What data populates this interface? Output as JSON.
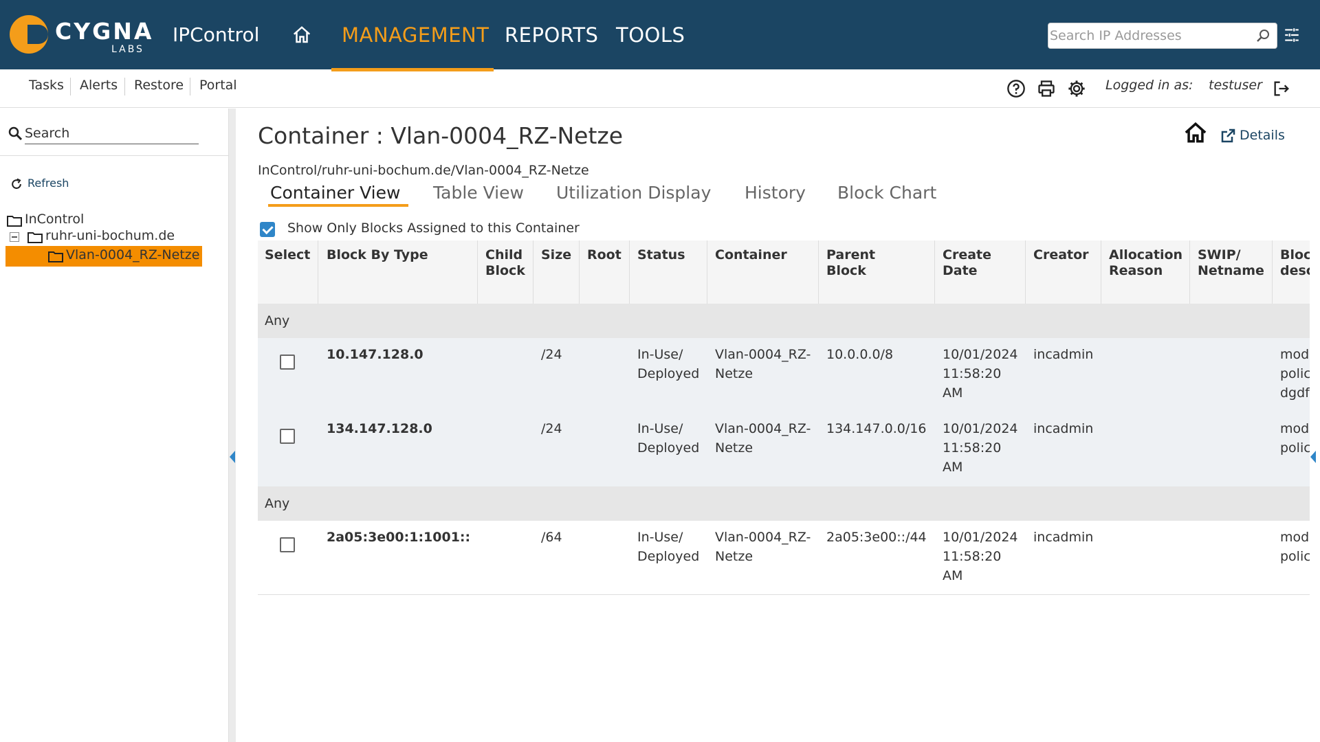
{
  "brand": {
    "logo_word": "CYGNA",
    "logo_sub": "LABS",
    "app_name": "IPControl"
  },
  "nav": {
    "items": [
      {
        "label": "MANAGEMENT",
        "active": true
      },
      {
        "label": "REPORTS",
        "active": false
      },
      {
        "label": "TOOLS",
        "active": false
      }
    ]
  },
  "search": {
    "placeholder": "Search IP Addresses",
    "value": ""
  },
  "subnav": {
    "links": [
      "Tasks",
      "Alerts",
      "Restore",
      "Portal"
    ],
    "logged_in_label": "Logged in as:",
    "username": "testuser"
  },
  "sidebar": {
    "search_placeholder": "Search",
    "refresh_label": "Refresh",
    "tree": [
      {
        "label": "InControl",
        "level": 0
      },
      {
        "label": "ruhr-uni-bochum.de",
        "level": 1
      },
      {
        "label": "Vlan-0004_RZ-Netze",
        "level": 2,
        "selected": true
      }
    ]
  },
  "page": {
    "title": "Container : Vlan-0004_RZ-Netze",
    "breadcrumb": "InControl/ruhr-uni-bochum.de/Vlan-0004_RZ-Netze",
    "details_label": "Details",
    "tabs": [
      {
        "label": "Container View",
        "active": true
      },
      {
        "label": "Table View",
        "active": false
      },
      {
        "label": "Utilization Display",
        "active": false
      },
      {
        "label": "History",
        "active": false
      },
      {
        "label": "Block Chart",
        "active": false
      }
    ],
    "show_only_label": "Show Only Blocks Assigned to this Container",
    "show_only_checked": true
  },
  "table": {
    "headers": {
      "select": "Select",
      "block_by_type": "Block By Type",
      "child_block_1": "Child",
      "child_block_2": "Block",
      "size": "Size",
      "root": "Root",
      "status": "Status",
      "container": "Container",
      "parent_block_1": "Parent",
      "parent_block_2": "Block",
      "create_date_1": "Create",
      "create_date_2": "Date",
      "creator": "Creator",
      "allocation_reason_1": "Allocation",
      "allocation_reason_2": "Reason",
      "swip_1": "SWIP/",
      "swip_2": "Netname",
      "block_desc_1": "Bloc",
      "block_desc_2": "desc"
    },
    "groups": [
      {
        "label": "Any",
        "rows": [
          {
            "block": "10.147.128.0",
            "size": "/24",
            "status_1": "In-Use/",
            "status_2": "Deployed",
            "container_1": "Vlan-0004_RZ-",
            "container_2": "Netze",
            "parent": "10.0.0.0/8",
            "date_1": "10/01/2024",
            "date_2": "11:58:20",
            "date_3": "AM",
            "creator": "incadmin",
            "desc_1": "modi",
            "desc_2": "polic",
            "desc_3": "dgdf"
          },
          {
            "block": "134.147.128.0",
            "size": "/24",
            "status_1": "In-Use/",
            "status_2": "Deployed",
            "container_1": "Vlan-0004_RZ-",
            "container_2": "Netze",
            "parent": "134.147.0.0/16",
            "date_1": "10/01/2024",
            "date_2": "11:58:20",
            "date_3": "AM",
            "creator": "incadmin",
            "desc_1": "modi",
            "desc_2": "polic"
          }
        ]
      },
      {
        "label": "Any",
        "rows": [
          {
            "block": "2a05:3e00:1:1001::",
            "size": "/64",
            "status_1": "In-Use/",
            "status_2": "Deployed",
            "container_1": "Vlan-0004_RZ-",
            "container_2": "Netze",
            "parent": "2a05:3e00::/44",
            "date_1": "10/01/2024",
            "date_2": "11:58:20",
            "date_3": "AM",
            "creator": "incadmin",
            "desc_1": "modi",
            "desc_2": "polic"
          }
        ]
      }
    ]
  },
  "colors": {
    "header_bg": "#1b4563",
    "accent": "#f49d1a",
    "selected_bg": "#f48d00",
    "link": "#1b4563"
  },
  "icons": [
    "home-icon",
    "search-icon",
    "tune-icon",
    "help-icon",
    "print-icon",
    "gear-icon",
    "logout-icon",
    "refresh-icon",
    "folder-icon",
    "external-link-icon",
    "checkbox-icon"
  ]
}
